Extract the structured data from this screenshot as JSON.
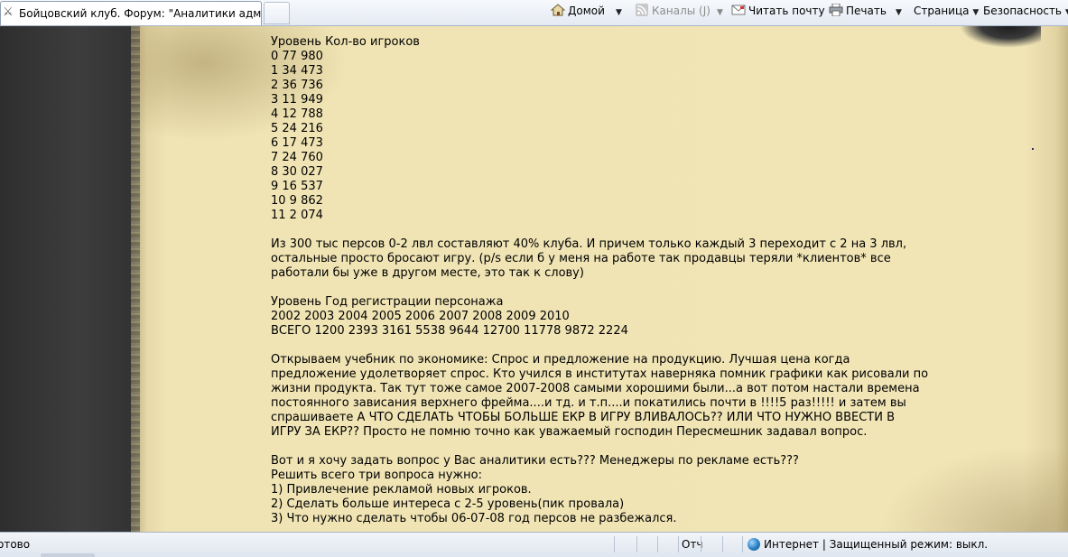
{
  "browser": {
    "tab_title": "Бойцовский клуб. Форум: \"Аналитики админо...",
    "commands": {
      "home": "Домой",
      "feeds": "Каналы (J)",
      "mail": "Читать почту",
      "print": "Печать",
      "page": "Страница",
      "safety": "Безопасность"
    },
    "status": {
      "text": "отово",
      "pane_partial": "Отч",
      "zone": "Интернет | Защищенный режим: выкл."
    }
  },
  "post": {
    "levels_header": "Уровень Кол-во игроков",
    "levels": [
      "0 77 980",
      "1 34 473",
      "2 36 736",
      "3 11 949",
      "4 12 788",
      "5 24 216",
      "6 17 473",
      "7 24 760",
      "8 30 027",
      "9 16 537",
      "10 9 862",
      "11 2 074"
    ],
    "para1": [
      "Из 300 тыс персов 0-2 лвл составляют 40% клуба. И причем только каждый 3 переходит с 2 на 3 лвл,",
      "остальные просто бросают игру. (p/s если б у меня на работе так продавцы теряли *клиентов* все",
      "работали бы уже в другом месте, это так к слову)"
    ],
    "reg_header": "Уровень Год регистрации персонажа",
    "reg_years": "2002 2003 2004 2005 2006 2007 2008 2009 2010",
    "reg_totals": "ВСЕГО 1200 2393 3161 5538 9644 12700 11778 9872 2224",
    "para2": [
      "Открываем учебник по экономике: Спрос и предложение на продукцию. Лучшая цена когда",
      "предложение удолетворяет спрос. Кто учился в институтах наверняка помник графики как рисовали по",
      "жизни продукта. Так тут тоже самое 2007-2008 самыми хорошими были...а вот потом настали времена",
      "постоянного зависания верхнего фрейма....и тд. и т.п....и покатились почти в !!!!5 раз!!!!! и затем вы",
      "спрашиваете А ЧТО СДЕЛАТЬ ЧТОБЫ БОЛЬШЕ ЕКР В ИГРУ ВЛИВАЛОСЬ?? ИЛИ ЧТО НУЖНО ВВЕСТИ В",
      "ИГРУ ЗА ЕКР?? Просто не помню точно как уважаемый господин Пересмешник задавал вопрос."
    ],
    "para3": [
      "Вот и я хочу задать вопрос у Вас аналитики есть??? Менеджеры по рекламе есть???",
      "Решить всего три вопроса нужно:",
      "1) Привлечение рекламой новых игроков.",
      "2) Сделать больше интереса с 2-5 уровень(пик провала)",
      "3) Что нужно сделать чтобы 06-07-08 год персов не разбежался."
    ]
  }
}
